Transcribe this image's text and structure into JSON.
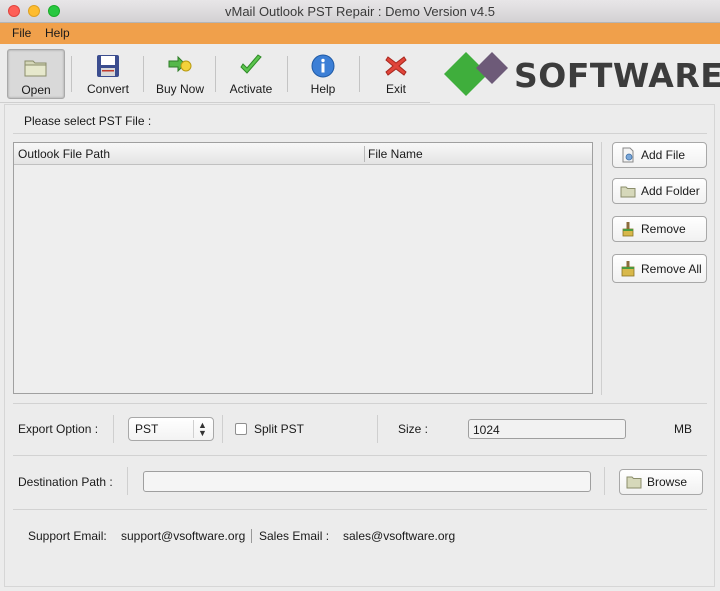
{
  "window": {
    "title": "vMail Outlook PST Repair : Demo Version v4.5"
  },
  "menu": {
    "file": "File",
    "help": "Help"
  },
  "toolbar": {
    "open": "Open",
    "convert": "Convert",
    "buy_now": "Buy Now",
    "activate": "Activate",
    "help": "Help",
    "exit": "Exit"
  },
  "logo": {
    "text": "SOFTWARE",
    "colors": {
      "green": "#3fae3c",
      "purple": "#6d5a78"
    }
  },
  "file_section": {
    "prompt": "Please select PST File :",
    "columns": [
      "Outlook File Path",
      "File Name"
    ],
    "rows": []
  },
  "side_buttons": {
    "add_file": "Add File",
    "add_folder": "Add Folder",
    "remove": "Remove",
    "remove_all": "Remove All"
  },
  "export": {
    "label": "Export Option :",
    "selected": "PST",
    "split_label": "Split PST",
    "split_checked": false,
    "size_label": "Size :",
    "size_value": "1024",
    "size_unit": "MB"
  },
  "destination": {
    "label": "Destination Path :",
    "value": "",
    "browse": "Browse"
  },
  "footer": {
    "support_label": "Support Email:",
    "support_email": "support@vsoftware.org",
    "sales_label": "Sales Email :",
    "sales_email": "sales@vsoftware.org"
  },
  "colors": {
    "menubar": "#f0a04b",
    "background": "#ececec"
  }
}
